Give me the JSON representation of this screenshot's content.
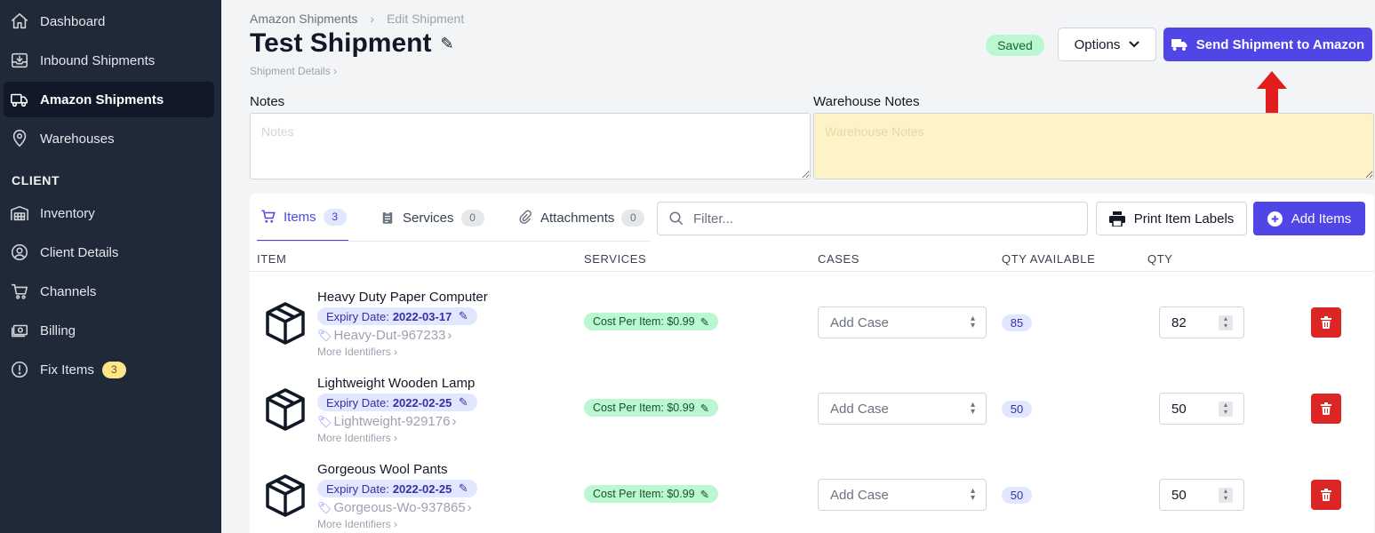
{
  "sidebar": {
    "items": [
      {
        "label": "Dashboard",
        "icon": "home-icon"
      },
      {
        "label": "Inbound Shipments",
        "icon": "inbox-icon"
      },
      {
        "label": "Amazon Shipments",
        "icon": "truck-icon",
        "active": true
      },
      {
        "label": "Warehouses",
        "icon": "map-pin-icon"
      }
    ],
    "section_label": "CLIENT",
    "client_items": [
      {
        "label": "Inventory",
        "icon": "warehouse-icon"
      },
      {
        "label": "Client Details",
        "icon": "user-circle-icon"
      },
      {
        "label": "Channels",
        "icon": "cart-icon"
      },
      {
        "label": "Billing",
        "icon": "cash-icon"
      },
      {
        "label": "Fix Items",
        "icon": "alert-circle-icon",
        "badge": "3"
      }
    ]
  },
  "header": {
    "breadcrumb": [
      "Amazon Shipments",
      "Edit Shipment"
    ],
    "title": "Test Shipment",
    "sub_link": "Shipment Details",
    "status": "Saved",
    "options_label": "Options",
    "send_label": "Send Shipment to Amazon"
  },
  "notes": {
    "label": "Notes",
    "placeholder": "Notes",
    "value": "",
    "warehouse_label": "Warehouse Notes",
    "warehouse_placeholder": "Warehouse Notes",
    "warehouse_value": ""
  },
  "tabs": [
    {
      "label": "Items",
      "count": "3",
      "active": true
    },
    {
      "label": "Services",
      "count": "0"
    },
    {
      "label": "Attachments",
      "count": "0"
    }
  ],
  "toolbar": {
    "filter_placeholder": "Filter...",
    "print_label": "Print Item Labels",
    "add_label": "Add Items"
  },
  "table": {
    "columns": [
      "ITEM",
      "SERVICES",
      "CASES",
      "QTY AVAILABLE",
      "QTY"
    ],
    "rows": [
      {
        "name": "Heavy Duty Paper Computer",
        "expiry_label": "Expiry Date:",
        "expiry": "2022-03-17",
        "identifier": "Heavy-Dut-967233",
        "more": "More Identifiers",
        "service": "Cost Per Item: $0.99",
        "case_placeholder": "Add Case",
        "qty_available": "85",
        "qty": "82"
      },
      {
        "name": "Lightweight Wooden Lamp",
        "expiry_label": "Expiry Date:",
        "expiry": "2022-02-25",
        "identifier": "Lightweight-929176",
        "more": "More Identifiers",
        "service": "Cost Per Item: $0.99",
        "case_placeholder": "Add Case",
        "qty_available": "50",
        "qty": "50"
      },
      {
        "name": "Gorgeous Wool Pants",
        "expiry_label": "Expiry Date:",
        "expiry": "2022-02-25",
        "identifier": "Gorgeous-Wo-937865",
        "more": "More Identifiers",
        "service": "Cost Per Item: $0.99",
        "case_placeholder": "Add Case",
        "qty_available": "50",
        "qty": "50"
      }
    ]
  },
  "colors": {
    "sidebar_bg": "#1f2937",
    "primary": "#4f46e5",
    "saved_bg": "#bbf7d0",
    "warehouse_notes_bg": "#fef3c7",
    "delete": "#dc2626",
    "arrow": "#e11d1d"
  }
}
